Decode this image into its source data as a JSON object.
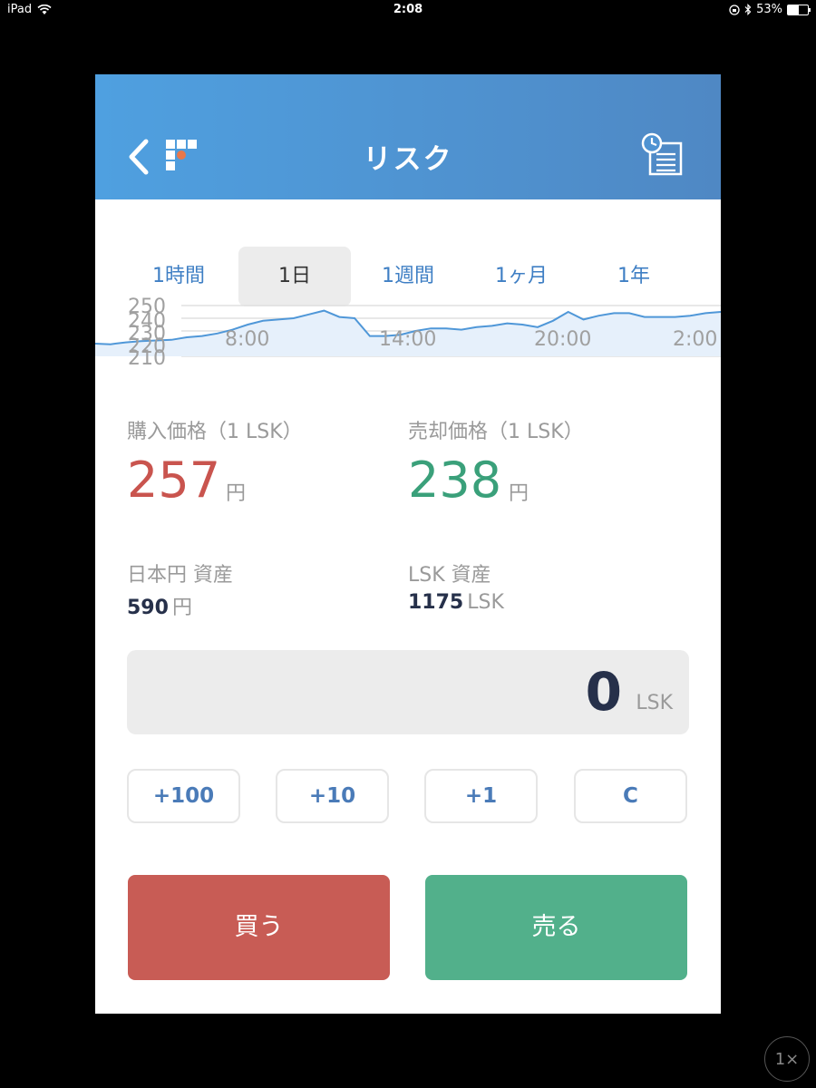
{
  "status_bar": {
    "device": "iPad",
    "time": "2:08",
    "battery": "53%",
    "battery_level": 0.53
  },
  "header": {
    "title": "リスク"
  },
  "period_tabs": [
    {
      "label": "1時間",
      "active": false
    },
    {
      "label": "1日",
      "active": true
    },
    {
      "label": "1週間",
      "active": false
    },
    {
      "label": "1ヶ月",
      "active": false
    },
    {
      "label": "1年",
      "active": false
    }
  ],
  "chart_data": {
    "type": "area",
    "y_ticks": [
      "250",
      "240",
      "230",
      "220",
      "210"
    ],
    "x_ticks": [
      "8:00",
      "14:00",
      "20:00",
      "2:00"
    ],
    "ylim": [
      210,
      250
    ],
    "values": [
      220,
      219.5,
      221,
      222,
      222.5,
      223,
      225,
      226,
      228,
      231,
      235,
      238,
      239,
      240,
      243,
      246,
      241,
      240,
      226,
      226,
      227,
      230,
      232,
      232,
      231,
      233,
      234,
      236,
      235,
      233,
      238,
      245,
      239,
      242,
      244,
      244,
      241,
      241,
      241,
      242,
      244,
      245
    ],
    "line_color": "#4f97d8",
    "fill_color": "#e6f0fb"
  },
  "prices": {
    "buy": {
      "label": "購入価格（1 LSK）",
      "value": "257",
      "unit": "円",
      "color": "#c9544e"
    },
    "sell": {
      "label": "売却価格（1 LSK）",
      "value": "238",
      "unit": "円",
      "color": "#3aa07a"
    }
  },
  "assets": {
    "jpy": {
      "label": "日本円 資産",
      "value": "590",
      "unit": "円"
    },
    "lsk": {
      "label": "LSK 資産",
      "value": "1175",
      "unit": "LSK"
    }
  },
  "amount": {
    "value": "0",
    "unit": "LSK"
  },
  "steps": [
    "+100",
    "+10",
    "+1",
    "C"
  ],
  "actions": {
    "buy": "買う",
    "sell": "売る",
    "buy_color": "#c85c55",
    "sell_color": "#52b08b"
  },
  "zoom": "1×"
}
